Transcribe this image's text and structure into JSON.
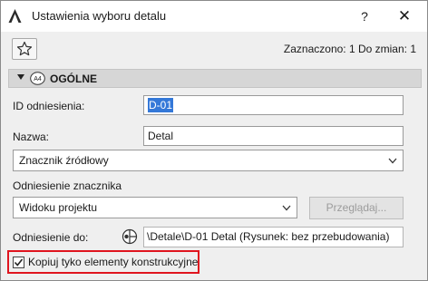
{
  "window": {
    "title": "Ustawienia wyboru detalu",
    "help_label": "?",
    "close_label": "✕"
  },
  "toolbar": {
    "favorites_icon": "star-icon",
    "status": "Zaznaczono: 1 Do zmian: 1"
  },
  "section": {
    "badge": "A4",
    "title": "OGÓLNE"
  },
  "fields": {
    "id_label": "ID odniesienia:",
    "id_value": "D-01",
    "name_label": "Nazwa:",
    "name_value": "Detal",
    "marker_dropdown": "Znacznik źródłowy",
    "marker_ref_label": "Odniesienie znacznika",
    "marker_ref_dropdown": "Widoku projektu",
    "browse_button": "Przeglądaj...",
    "ref_to_label": "Odniesienie do:",
    "ref_to_path": "\\Detale\\D-01 Detal (Rysunek: bez przebudowania)",
    "copy_checkbox_label": "Kopiuj tyko elementy konstrukcyjne",
    "copy_checkbox_checked": true
  },
  "colors": {
    "selection": "#3478d8",
    "highlight_border": "#e0141e"
  }
}
